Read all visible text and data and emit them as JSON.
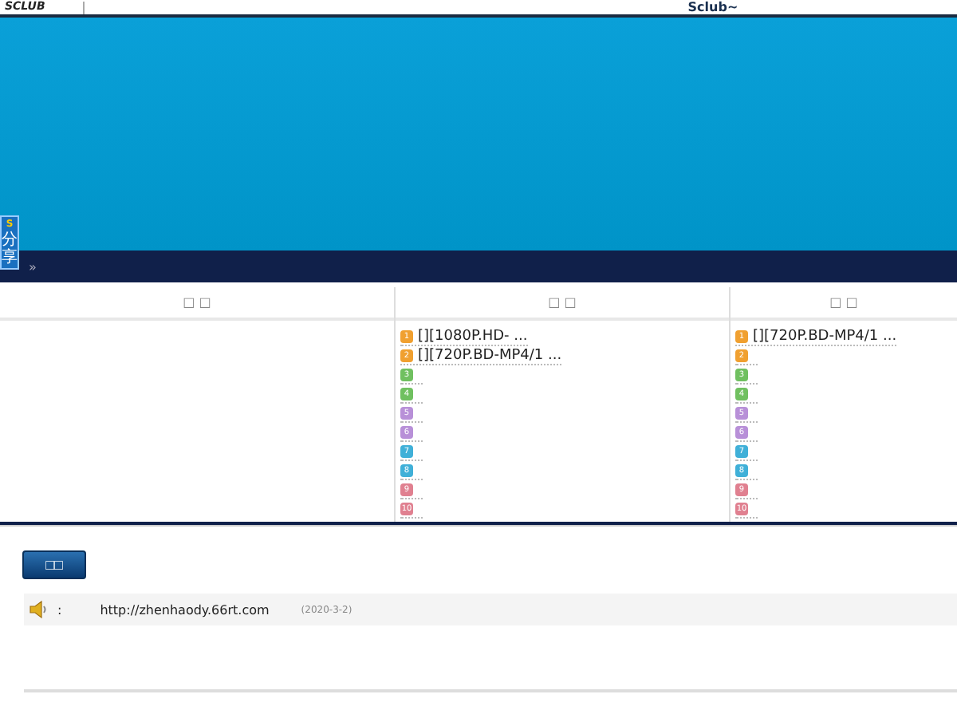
{
  "top_bar": {
    "logo": "SCLUB",
    "title": "Sclub~"
  },
  "share_widget": {
    "badge": "S",
    "label": "分享"
  },
  "nav_bar": {
    "arrow": "»"
  },
  "columns": [
    {
      "header": "□ □"
    },
    {
      "header": "□ □",
      "items": [
        {
          "rank": "1",
          "title": "[][1080P.HD- ...",
          "color": "#f0a030"
        },
        {
          "rank": "2",
          "title": "[][720P.BD-MP4/1 ...",
          "color": "#f0a030"
        },
        {
          "rank": "3",
          "color": "#70c060"
        },
        {
          "rank": "4",
          "color": "#70c060"
        },
        {
          "rank": "5",
          "color": "#b890d8"
        },
        {
          "rank": "6",
          "color": "#b890d8"
        },
        {
          "rank": "7",
          "color": "#40b0d8"
        },
        {
          "rank": "8",
          "color": "#40b0d8"
        },
        {
          "rank": "9",
          "color": "#e08090"
        },
        {
          "rank": "10",
          "color": "#e08090"
        }
      ]
    },
    {
      "header": "□ □",
      "items": [
        {
          "rank": "1",
          "title": "[][720P.BD-MP4/1 ...",
          "color": "#f0a030"
        },
        {
          "rank": "2",
          "color": "#f0a030"
        },
        {
          "rank": "3",
          "color": "#70c060"
        },
        {
          "rank": "4",
          "color": "#70c060"
        },
        {
          "rank": "5",
          "color": "#b890d8"
        },
        {
          "rank": "6",
          "color": "#b890d8"
        },
        {
          "rank": "7",
          "color": "#40b0d8"
        },
        {
          "rank": "8",
          "color": "#40b0d8"
        },
        {
          "rank": "9",
          "color": "#e08090"
        },
        {
          "rank": "10",
          "color": "#e08090"
        }
      ]
    }
  ],
  "button": "□□",
  "notice": {
    "colon": ":",
    "url": "http://zhenhaody.66rt.com",
    "date": "(2020-3-2)"
  }
}
